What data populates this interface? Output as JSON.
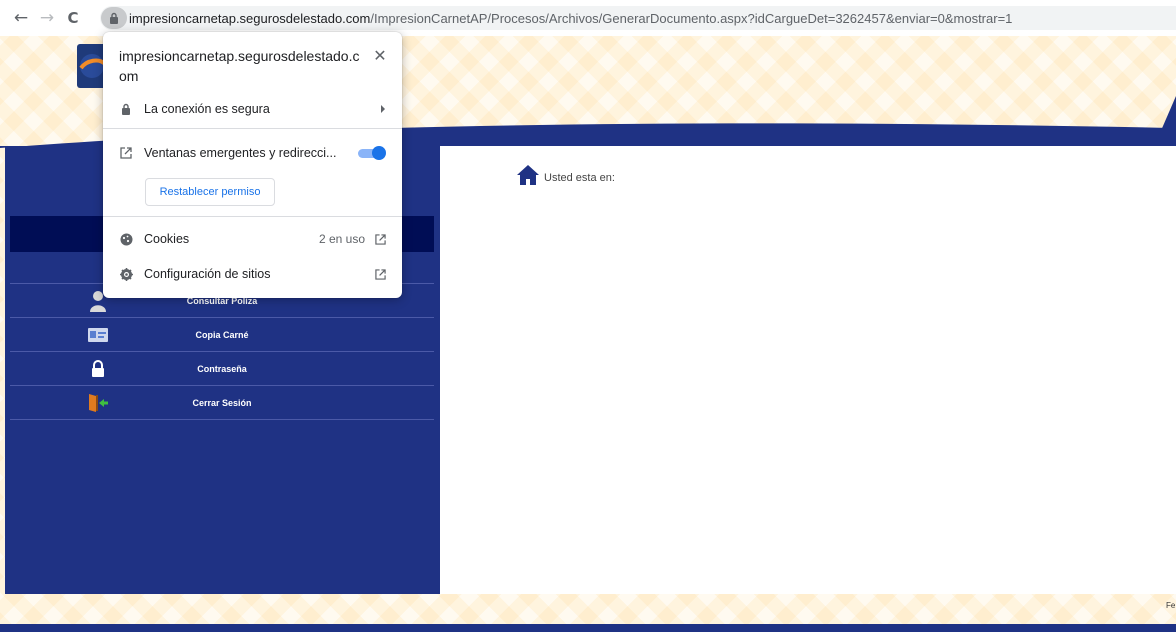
{
  "browser": {
    "back_icon": "←",
    "forward_icon": "→",
    "reload_icon": "C",
    "url_host": "impresioncarnetap.segurosdelestado.com",
    "url_path": "/ImpresionCarnetAP/Procesos/Archivos/GenerarDocumento.aspx?idCargueDet=3262457&enviar=0&mostrar=1"
  },
  "site_info": {
    "title": "impresioncarnetap.segurosdelestado.com",
    "close_icon": "✕",
    "connection_label": "La conexión es segura",
    "popups_label": "Ventanas emergentes y redirecci...",
    "popups_enabled": true,
    "reset_button": "Restablecer permiso",
    "cookies_label": "Cookies",
    "cookies_count": "2 en uso",
    "site_settings_label": "Configuración de sitios"
  },
  "sidebar": {
    "items": [
      {
        "label": "Consultar Poliza",
        "icon": "user-icon"
      },
      {
        "label": "Copia Carné",
        "icon": "id-card-icon"
      },
      {
        "label": "Contraseña",
        "icon": "padlock-icon"
      },
      {
        "label": "Cerrar Sesión",
        "icon": "exit-door-icon"
      }
    ]
  },
  "content": {
    "breadcrumb": "Usted esta en:"
  },
  "footer": {
    "text": "Fe"
  },
  "colors": {
    "navy": "#1f3284",
    "dark_navy": "#000d55",
    "toggle_blue": "#1a73e8"
  }
}
